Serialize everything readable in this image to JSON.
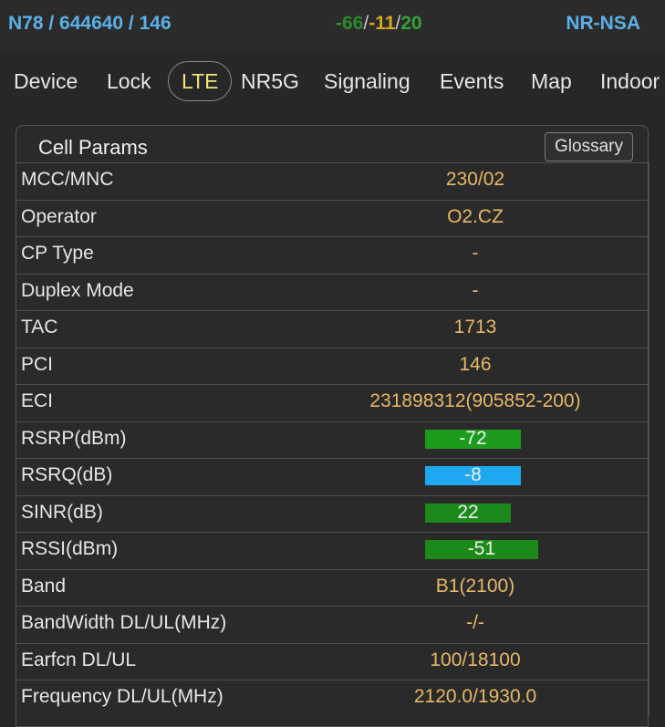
{
  "status": {
    "band_info": "N78 / 644640 / 146",
    "signal_a": "-66",
    "signal_b": "-11",
    "signal_c": "20",
    "separator": "/",
    "network_mode": "NR-NSA",
    "colors": {
      "signal_a": "#2b8a2b",
      "signal_b": "#d6a81e",
      "signal_c": "#35a335"
    }
  },
  "tabs": [
    {
      "label": "Device"
    },
    {
      "label": "Lock"
    },
    {
      "label": "LTE",
      "active": true
    },
    {
      "label": "NR5G"
    },
    {
      "label": "Signaling"
    },
    {
      "label": "Events"
    },
    {
      "label": "Map"
    },
    {
      "label": "Indoor"
    }
  ],
  "card": {
    "title": "Cell Params",
    "glossary_label": "Glossary"
  },
  "rows": [
    {
      "label": "MCC/MNC",
      "value": "230/02"
    },
    {
      "label": "Operator",
      "value": "O2.CZ"
    },
    {
      "label": "CP Type",
      "value": "-"
    },
    {
      "label": "Duplex Mode",
      "value": "-"
    },
    {
      "label": "TAC",
      "value": "1713"
    },
    {
      "label": "PCI",
      "value": "146"
    },
    {
      "label": "ECI",
      "value": "231898312(905852-200)"
    },
    {
      "label": "RSRP(dBm)",
      "value": "-72",
      "level": 0.85,
      "bar_color": "#1b9a1b"
    },
    {
      "label": "RSRQ(dB)",
      "value": "-8",
      "level": 0.85,
      "bar_color": "#1ea8f0"
    },
    {
      "label": "SINR(dB)",
      "value": "22",
      "level": 0.76,
      "bar_color": "#1b8a1b"
    },
    {
      "label": "RSSI(dBm)",
      "value": "-51",
      "level": 1.0,
      "bar_color": "#1b8a1b"
    },
    {
      "label": "Band",
      "value": "B1(2100)"
    },
    {
      "label": "BandWidth DL/UL(MHz)",
      "value": "-/-"
    },
    {
      "label": "Earfcn DL/UL",
      "value": "100/18100"
    },
    {
      "label": "Frequency DL/UL(MHz)",
      "value": "2120.0/1930.0"
    }
  ]
}
